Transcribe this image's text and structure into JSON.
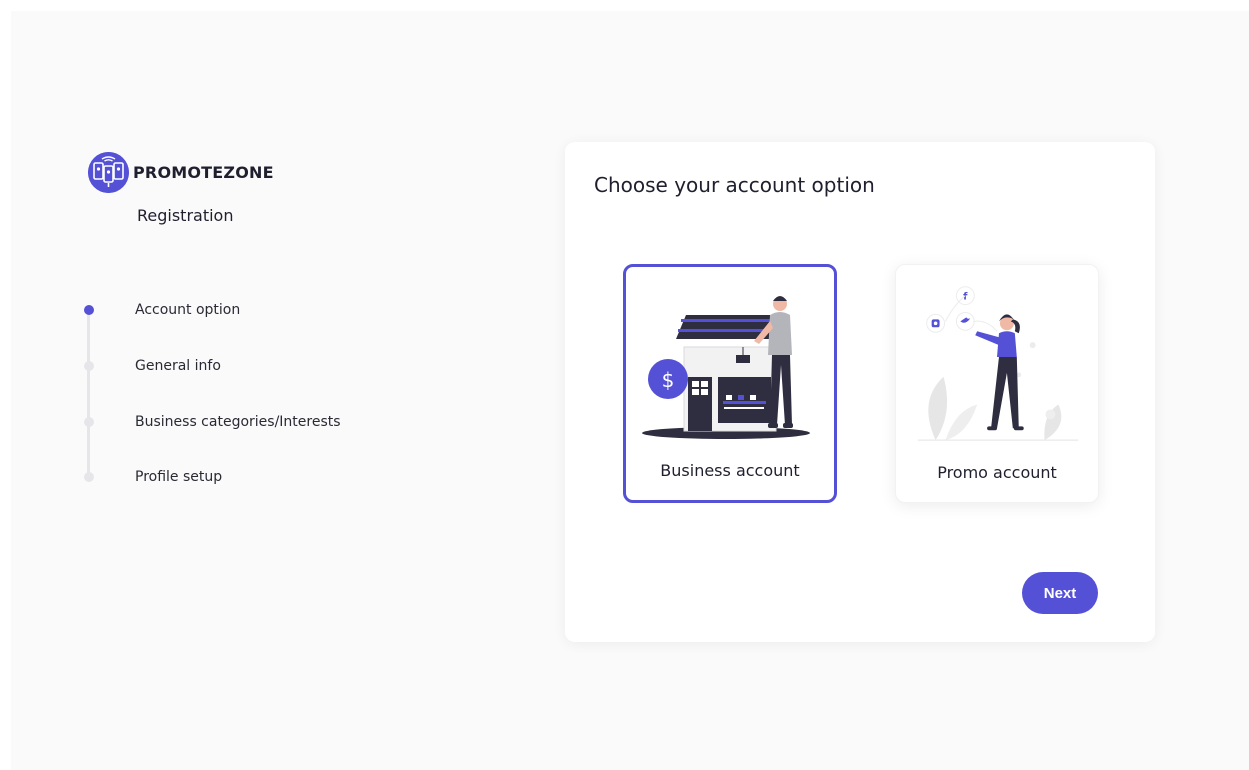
{
  "brand": {
    "name": "PROMOTEZONE",
    "logo_icon": "promotezone-logo-icon"
  },
  "sidebar": {
    "section_title": "Registration",
    "steps": [
      {
        "label": "Account option",
        "state": "active"
      },
      {
        "label": "General info",
        "state": "inactive"
      },
      {
        "label": "Business categories/Interests",
        "state": "inactive"
      },
      {
        "label": "Profile setup",
        "state": "inactive"
      }
    ]
  },
  "card": {
    "title": "Choose your account option",
    "options": [
      {
        "label": "Business account",
        "selected": true,
        "illustration": "storefront-illustration"
      },
      {
        "label": "Promo account",
        "selected": false,
        "illustration": "social-promoter-illustration"
      }
    ],
    "next_label": "Next"
  },
  "colors": {
    "accent": "#5451d6",
    "background": "#fafafa",
    "card": "#ffffff",
    "text": "#1f1f2e",
    "rail": "#e6e6ea"
  }
}
